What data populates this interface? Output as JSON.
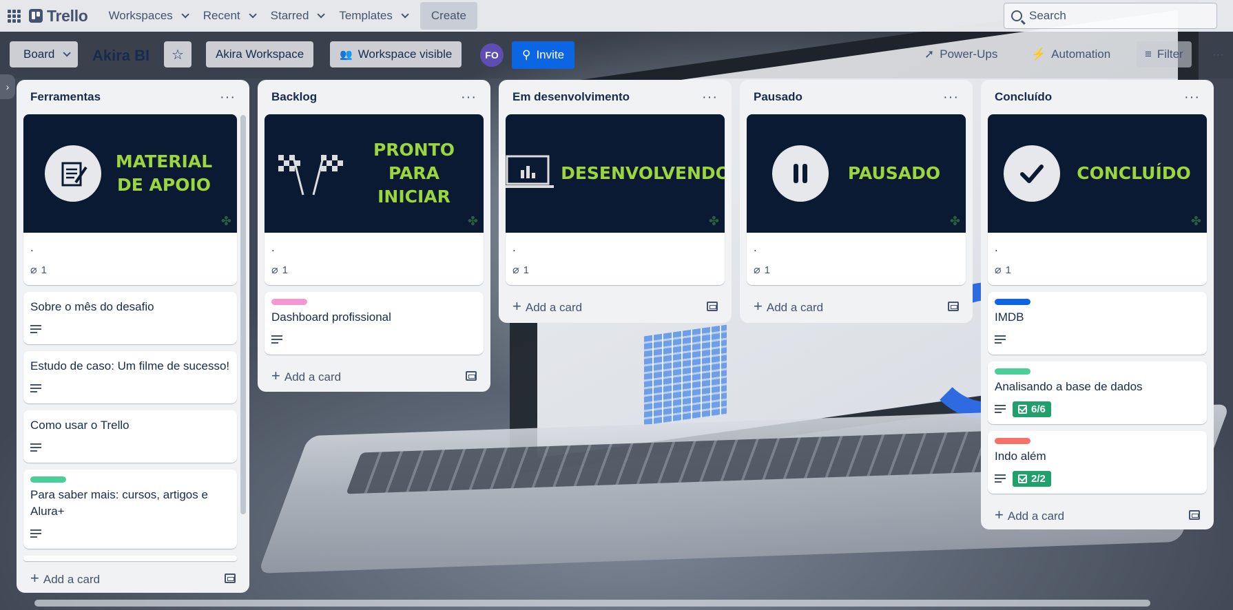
{
  "topbar": {
    "logo": "Trello",
    "nav": [
      "Workspaces",
      "Recent",
      "Starred",
      "Templates"
    ],
    "create": "Create",
    "search_placeholder": "Search"
  },
  "board_header": {
    "view": "Board",
    "title": "Akira BI",
    "workspace": "Akira Workspace",
    "visibility": "Workspace visible",
    "avatar_initials": "FO",
    "invite": "Invite",
    "power_ups": "Power-Ups",
    "automation": "Automation",
    "filter": "Filter"
  },
  "lists": [
    {
      "title": "Ferramentas",
      "cover_text": "MATERIAL DE APOIO",
      "cover_icon": "notepad-icon",
      "cover_card_title": ".",
      "cover_attachments": "1",
      "cards": [
        {
          "title": "Sobre o mês do desafio"
        },
        {
          "title": "Estudo de caso: Um filme de sucesso!"
        },
        {
          "title": "Como usar o Trello"
        },
        {
          "title": "Para saber mais: cursos, artigos e Alura+",
          "label": "#4bce97"
        }
      ],
      "add_card": "Add a card"
    },
    {
      "title": "Backlog",
      "cover_text": "PRONTO PARA INICIAR",
      "cover_icon": "checkered-flags-icon",
      "cover_card_title": ".",
      "cover_attachments": "1",
      "cards": [
        {
          "title": "Dashboard profissional",
          "label": "#f797d2"
        }
      ],
      "add_card": "Add a card"
    },
    {
      "title": "Em desenvolvimento",
      "cover_text": "DESENVOLVENDO",
      "cover_icon": "laptop-chart-icon",
      "cover_card_title": ".",
      "cover_attachments": "1",
      "add_card": "Add a card"
    },
    {
      "title": "Pausado",
      "cover_text": "PAUSADO",
      "cover_icon": "pause-icon",
      "cover_card_title": ".",
      "cover_attachments": "1",
      "add_card": "Add a card"
    },
    {
      "title": "Concluído",
      "cover_text": "CONCLUÍDO",
      "cover_icon": "checkmark-icon",
      "cover_card_title": ".",
      "cover_attachments": "1",
      "cards": [
        {
          "title": "IMDB",
          "label": "#0c66e4"
        },
        {
          "title": "Analisando a base de dados",
          "label": "#4bce97",
          "checklist": "6/6"
        },
        {
          "title": "Indo além",
          "label": "#f87168",
          "checklist": "2/2"
        }
      ],
      "add_card": "Add a card"
    }
  ]
}
